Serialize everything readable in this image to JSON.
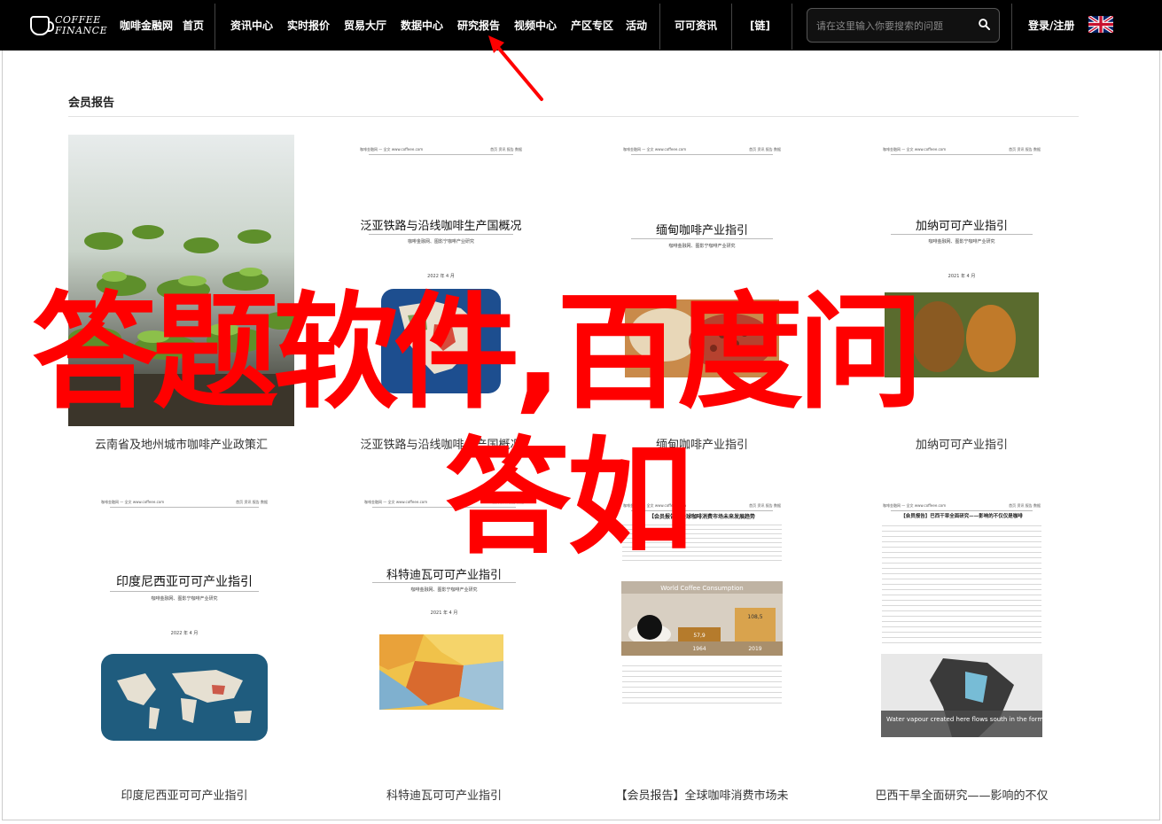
{
  "nav": {
    "logo_line1": "COFFEE",
    "logo_line2": "FINANCE",
    "items": [
      "咖啡金融网",
      "首页",
      "资讯中心",
      "实时报价",
      "贸易大厅",
      "数据中心",
      "研究报告",
      "视频中心",
      "产区专区",
      "活动",
      "可可资讯",
      "[链]"
    ],
    "search_placeholder": "请在这里输入你要搜索的问题",
    "login": "登录/注册"
  },
  "section_title": "会员报告",
  "reports": [
    {
      "caption": "云南省及地州城市咖啡产业政策汇",
      "doc_title": "",
      "doc_sub": "",
      "doc_date": ""
    },
    {
      "caption": "泛亚铁路与沿线咖啡生产国概况",
      "doc_title": "泛亚铁路与沿线咖啡生产国概况",
      "doc_sub": "咖啡金融网、图影宁咖啡产业研究",
      "doc_date": "2022 年 4 月"
    },
    {
      "caption": "缅甸咖啡产业指引",
      "doc_title": "缅甸咖啡产业指引",
      "doc_sub": "咖啡金融网、图影宁咖啡产业研究",
      "doc_date": ""
    },
    {
      "caption": "加纳可可产业指引",
      "doc_title": "加纳可可产业指引",
      "doc_sub": "咖啡金融网、图影宁咖啡产业研究",
      "doc_date": "2021 年 4 月"
    },
    {
      "caption": "印度尼西亚可可产业指引",
      "doc_title": "印度尼西亚可可产业指引",
      "doc_sub": "咖啡金融网、图影宁咖啡产业研究",
      "doc_date": "2022 年 4 月"
    },
    {
      "caption": "科特迪瓦可可产业指引",
      "doc_title": "科特迪瓦可可产业指引",
      "doc_sub": "咖啡金融网、图影宁咖啡产业研究",
      "doc_date": "2021 年 4 月"
    },
    {
      "caption": "【会员报告】全球咖啡消费市场未",
      "doc_title": "【会员报告】全球咖啡消费市场未来发展趋势",
      "doc_sub": "",
      "doc_date": "",
      "chart_label": "World Coffee Consumption",
      "bar1": "57,9",
      "bar2": "108,5",
      "year1": "1964",
      "year2": "2019"
    },
    {
      "caption": "巴西干旱全面研究——影响的不仅",
      "doc_title": "【会员报告】巴西干旱全面研究——影响的不仅仅是咖啡",
      "doc_sub": "",
      "doc_date": "",
      "map_text": "Water vapour created here flows south in the form of 'flying rivers'."
    }
  ],
  "overlay": {
    "line1": "答题软件,百度问",
    "line2": "答如"
  },
  "colors": {
    "nav_bg": "#000000",
    "overlay": "#ff0000",
    "arrow": "#ff0000"
  }
}
